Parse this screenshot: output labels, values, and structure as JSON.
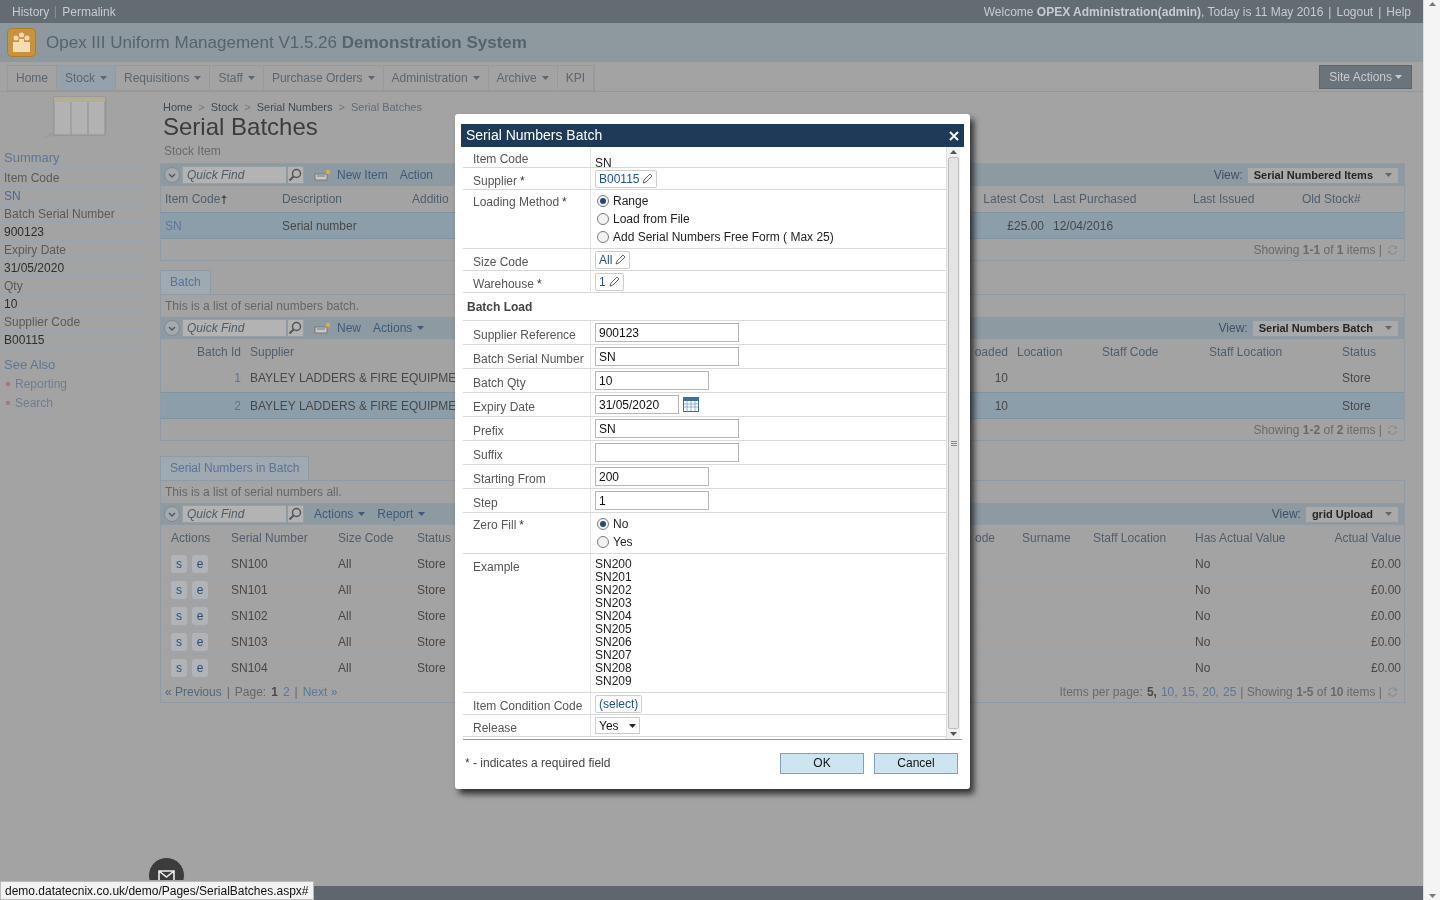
{
  "top_bar": {
    "links": [
      "History",
      "Permalink"
    ],
    "welcome": "Welcome **OPEX Administration(admin)**, Today is 11 May 2016",
    "separator": "|",
    "right_links": [
      "Logout",
      "Help"
    ]
  },
  "header": {
    "title": "Opex III Uniform Management V1.5.26 **Demonstration System**"
  },
  "nav": {
    "items": [
      {
        "label": "Home",
        "dropdown": false,
        "selected": false
      },
      {
        "label": "Stock",
        "dropdown": true,
        "selected": true
      },
      {
        "label": "Requisitions",
        "dropdown": true,
        "selected": false
      },
      {
        "label": "Staff",
        "dropdown": true,
        "selected": false
      },
      {
        "label": "Purchase Orders",
        "dropdown": true,
        "selected": false
      },
      {
        "label": "Administration",
        "dropdown": true,
        "selected": false
      },
      {
        "label": "Archive",
        "dropdown": true,
        "selected": false
      },
      {
        "label": "KPI",
        "dropdown": false,
        "selected": false
      }
    ],
    "site_actions": "Site Actions"
  },
  "sidebar": {
    "summary_title": "Summary",
    "fields": [
      {
        "label": "Item Code",
        "value": "SN",
        "link": true
      },
      {
        "label": "Batch Serial Number",
        "value": "900123",
        "link": false
      },
      {
        "label": "Expiry Date",
        "value": "31/05/2020",
        "link": false
      },
      {
        "label": "Qty",
        "value": "10",
        "link": false
      },
      {
        "label": "Supplier Code",
        "value": "B00115",
        "link": false
      }
    ],
    "see_also_title": "See Also",
    "links": [
      "Reporting",
      "Search"
    ]
  },
  "breadcrumb": {
    "separator": ">",
    "items": [
      {
        "label": "Home",
        "current": false
      },
      {
        "label": "Stock",
        "current": false
      },
      {
        "label": "Serial Numbers",
        "current": false
      },
      {
        "label": "Serial Batches",
        "current": true
      }
    ]
  },
  "page_title": "Serial Batches",
  "grids": [
    {
      "title": "Stock Item",
      "toolbar": {
        "placeholder": "Quick Find",
        "buttons": [
          {
            "kind": "new",
            "label": "New Item",
            "dropdown": false
          },
          {
            "kind": "menu",
            "label": "Action",
            "dropdown": false
          }
        ]
      },
      "view": {
        "label": "View:",
        "value": "Serial Numbered Items"
      },
      "rows": [
        {
          "selected": true
        }
      ],
      "left_columns": [
        {
          "label": "Item Code",
          "kind": "link",
          "sorted": true,
          "values": [
            "SN"
          ]
        },
        {
          "label": "Description",
          "kind": "text",
          "sorted": false,
          "values": [
            "Serial number"
          ]
        },
        {
          "label": "Additio",
          "kind": "text",
          "sorted": false
        }
      ],
      "right_columns": [
        {
          "label": "Latest Cost",
          "kind": "number",
          "sorted": false,
          "values": [
            "£25.00"
          ]
        },
        {
          "label": "Last Purchased",
          "kind": "text",
          "sorted": false,
          "values": [
            "12/04/2016"
          ]
        },
        {
          "label": "Last Issued",
          "kind": "text",
          "sorted": false
        },
        {
          "label": "Old Stock#",
          "kind": "text",
          "sorted": false
        }
      ],
      "footer": {
        "summary": "Showing **1-1** of **1** items |"
      }
    },
    {
      "tab": "Batch",
      "description": "This is a list of serial numbers batch.",
      "toolbar": {
        "placeholder": "Quick Find",
        "buttons": [
          {
            "kind": "new",
            "label": "New",
            "dropdown": false
          },
          {
            "kind": "menu",
            "label": "Actions",
            "dropdown": true
          }
        ]
      },
      "view": {
        "label": "View:",
        "value": "Serial Numbers Batch"
      },
      "rows": [
        {
          "selected": false
        },
        {
          "selected": true
        }
      ],
      "left_columns": [
        {
          "label": "Batch Id",
          "kind": "id",
          "sorted": false,
          "values": [
            "1",
            "2"
          ]
        },
        {
          "label": "Supplier",
          "kind": "text",
          "sorted": false,
          "values": [
            "BAYLEY LADDERS & FIRE EQUIPME",
            "BAYLEY LADDERS & FIRE EQUIPME"
          ]
        }
      ],
      "right_columns": [
        {
          "label": "oaded",
          "kind": "number",
          "sorted": false,
          "values": [
            "10",
            "10"
          ]
        },
        {
          "label": "Location",
          "kind": "text",
          "sorted": false
        },
        {
          "label": "Staff Code",
          "kind": "text",
          "sorted": false
        },
        {
          "label": "Staff Location",
          "kind": "text",
          "sorted": false
        },
        {
          "label": "Status",
          "kind": "text",
          "sorted": false,
          "values": [
            "Store",
            "Store"
          ]
        }
      ],
      "footer": {
        "summary": "Showing **1-2** of **2** items |"
      }
    },
    {
      "tab": "Serial Numbers in Batch",
      "description": "This is a list of serial numbers all.",
      "toolbar": {
        "placeholder": "Quick Find",
        "buttons": [
          {
            "kind": "menu",
            "label": "Actions",
            "dropdown": true
          },
          {
            "kind": "menu",
            "label": "Report",
            "dropdown": true
          }
        ]
      },
      "view": {
        "label": "View:",
        "value": "grid Upload"
      },
      "rows": [
        {
          "selected": false
        },
        {
          "selected": false
        },
        {
          "selected": false
        },
        {
          "selected": false
        },
        {
          "selected": false
        }
      ],
      "left_columns": [
        {
          "label": "Actions",
          "kind": "actions",
          "sorted": false,
          "values": [
            [
              "s",
              "e"
            ],
            [
              "s",
              "e"
            ],
            [
              "s",
              "e"
            ],
            [
              "s",
              "e"
            ],
            [
              "s",
              "e"
            ]
          ]
        },
        {
          "label": "Serial Number",
          "kind": "text",
          "sorted": false,
          "values": [
            "SN100",
            "SN101",
            "SN102",
            "SN103",
            "SN104"
          ]
        },
        {
          "label": "Size Code",
          "kind": "text",
          "sorted": false,
          "values": [
            "All",
            "All",
            "All",
            "All",
            "All"
          ]
        },
        {
          "label": "Status",
          "kind": "text",
          "sorted": false,
          "values": [
            "Store",
            "Store",
            "Store",
            "Store",
            "Store"
          ]
        }
      ],
      "right_columns": [
        {
          "label": "ode",
          "kind": "text",
          "sorted": false
        },
        {
          "label": "Surname",
          "kind": "text",
          "sorted": false
        },
        {
          "label": "Staff Location",
          "kind": "text",
          "sorted": false
        },
        {
          "label": "Has Actual Value",
          "kind": "text",
          "sorted": false,
          "values": [
            "No",
            "No",
            "No",
            "No",
            "No"
          ]
        },
        {
          "label": "Actual Value",
          "kind": "number",
          "sorted": false,
          "values": [
            "£0.00",
            "£0.00",
            "£0.00",
            "£0.00",
            "£0.00"
          ]
        }
      ],
      "footer": {
        "pager": {
          "previous": "« Previous",
          "separator": "|",
          "page_label": "Page:",
          "pages": [
            {
              "label": "1",
              "selected": true
            },
            {
              "label": "2",
              "selected": false
            }
          ],
          "next": "Next »"
        },
        "per_page": {
          "label": "Items per page:",
          "separator": ",",
          "options": [
            {
              "label": "5",
              "selected": true
            },
            {
              "label": "10",
              "selected": false
            },
            {
              "label": "15",
              "selected": false
            },
            {
              "label": "20",
              "selected": false
            },
            {
              "label": "25",
              "selected": false
            }
          ]
        },
        "summary": "| Showing **1-5** of **10** items |"
      }
    }
  ],
  "dialog": {
    "title": "Serial Numbers Batch",
    "required_mark": "*",
    "fields": [
      {
        "kind": "text",
        "label": "Item Code",
        "required": false,
        "value": "SN"
      },
      {
        "kind": "lookup",
        "label": "Supplier",
        "required": true,
        "value": "B00115"
      },
      {
        "kind": "radio",
        "label": "Loading Method",
        "required": true,
        "options": [
          {
            "label": "Range",
            "selected": true
          },
          {
            "label": "Load from File",
            "selected": false
          },
          {
            "label": "Add Serial Numbers Free Form ( Max 25)",
            "selected": false
          }
        ]
      },
      {
        "kind": "lookup",
        "label": "Size Code",
        "required": false,
        "value": "All"
      },
      {
        "kind": "lookup",
        "label": "Warehouse",
        "required": true,
        "value": "1"
      },
      {
        "kind": "section",
        "label": "Batch Load"
      },
      {
        "kind": "input",
        "label": "Supplier Reference",
        "required": false,
        "value": "900123"
      },
      {
        "kind": "input",
        "label": "Batch Serial Number",
        "required": false,
        "value": "SN"
      },
      {
        "kind": "number",
        "label": "Batch Qty",
        "required": false,
        "value": "10"
      },
      {
        "kind": "date",
        "label": "Expiry Date",
        "required": false,
        "value": "31/05/2020"
      },
      {
        "kind": "input",
        "label": "Prefix",
        "required": false,
        "value": "SN"
      },
      {
        "kind": "input",
        "label": "Suffix",
        "required": false
      },
      {
        "kind": "number",
        "label": "Starting From",
        "required": false,
        "value": "200"
      },
      {
        "kind": "number",
        "label": "Step",
        "required": false,
        "value": "1"
      },
      {
        "kind": "radio",
        "label": "Zero Fill",
        "required": true,
        "options": [
          {
            "label": "No",
            "selected": true
          },
          {
            "label": "Yes",
            "selected": false
          }
        ]
      },
      {
        "kind": "list",
        "label": "Example",
        "required": false,
        "values": [
          "SN200",
          "SN201",
          "SN202",
          "SN203",
          "SN204",
          "SN205",
          "SN206",
          "SN207",
          "SN208",
          "SN209"
        ]
      },
      {
        "kind": "picker",
        "label": "Item Condition Code",
        "required": false,
        "value": "(select)"
      },
      {
        "kind": "select",
        "label": "Release",
        "required": false,
        "value": "Yes"
      }
    ],
    "note": "* - indicates a required field",
    "buttons": [
      "OK",
      "Cancel"
    ]
  },
  "status_url": "demo.datatecnix.co.uk/demo/Pages/SerialBatches.aspx#"
}
